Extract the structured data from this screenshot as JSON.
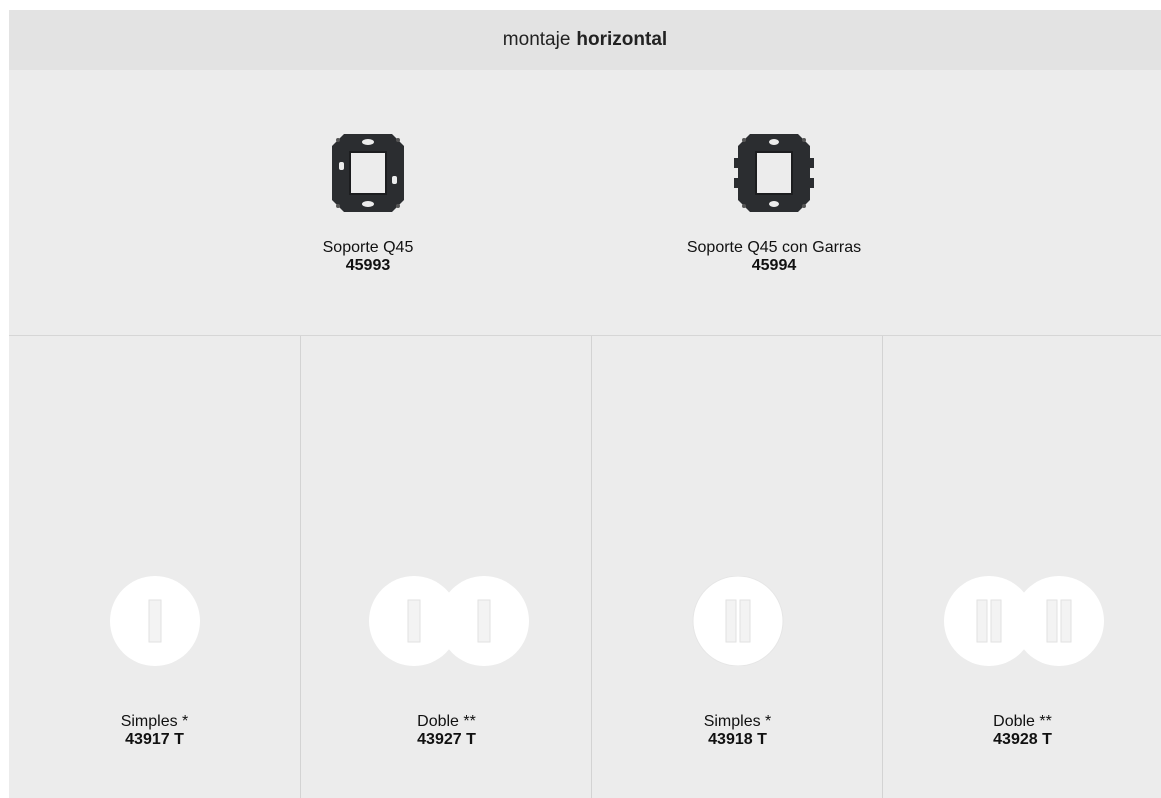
{
  "header": {
    "prefix": "montaje",
    "emphasis": "horizontal"
  },
  "supports": [
    {
      "name": "Soporte Q45",
      "code": "45993",
      "icon": "mounting-frame-icon"
    },
    {
      "name": "Soporte Q45 con Garras",
      "code": "45994",
      "icon": "mounting-frame-claws-icon"
    }
  ],
  "plates": [
    {
      "name": "Simples *",
      "code": "43917 T",
      "icon": "single-plate-one-slot-icon"
    },
    {
      "name": "Doble **",
      "code": "43927 T",
      "icon": "double-plate-one-slot-icon"
    },
    {
      "name": "Simples *",
      "code": "43918 T",
      "icon": "single-plate-two-slot-icon"
    },
    {
      "name": "Doble **",
      "code": "43928 T",
      "icon": "double-plate-two-slot-icon"
    }
  ],
  "colors": {
    "panel": "#ececec",
    "header": "#e3e3e3",
    "frame": "#2b2d30",
    "plate": "#ffffff"
  }
}
